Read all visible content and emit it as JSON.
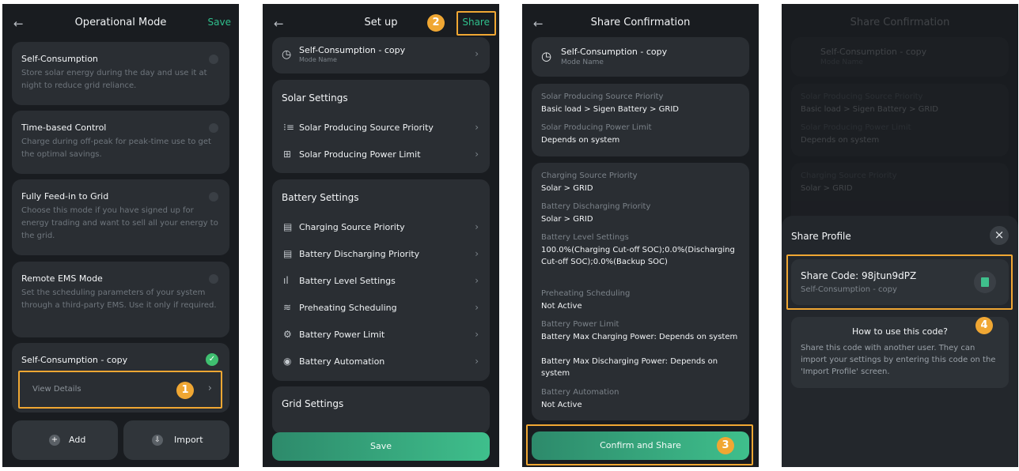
{
  "panel1": {
    "title": "Operational Mode",
    "save": "Save",
    "back": "←",
    "modes": [
      {
        "name": "Self-Consumption",
        "desc": "Store solar energy during the day and use it at night to reduce grid reliance."
      },
      {
        "name": "Time-based Control",
        "desc": "Charge during off-peak for peak-time use to get the optimal savings."
      },
      {
        "name": "Fully Feed-in to Grid",
        "desc": "Choose this mode if you have signed up for energy trading and want to sell all your energy to the grid."
      },
      {
        "name": "Remote EMS Mode",
        "desc": "Set the scheduling parameters of your system through a third-party EMS. Use it only if required."
      }
    ],
    "custom": {
      "name": "Self-Consumption - copy",
      "view": "View Details",
      "check": "✓"
    },
    "add": "Add",
    "import": "Import",
    "badge": "1"
  },
  "panel2": {
    "title": "Set up",
    "share": "Share",
    "back": "←",
    "badge": "2",
    "mode_name": "Self-Consumption - copy",
    "mode_label": "Mode Name",
    "solar_title": "Solar Settings",
    "solar_items": [
      "Solar Producing Source Priority",
      "Solar Producing Power Limit"
    ],
    "battery_title": "Battery Settings",
    "battery_items": [
      "Charging Source Priority",
      "Battery Discharging Priority",
      "Battery Level Settings",
      "Preheating Scheduling",
      "Battery Power Limit",
      "Battery Automation"
    ],
    "grid_title": "Grid Settings",
    "save": "Save"
  },
  "panel3": {
    "title": "Share Confirmation",
    "back": "←",
    "badge": "3",
    "mode_name": "Self-Consumption - copy",
    "mode_label": "Mode Name",
    "solar": [
      {
        "k": "Solar Producing Source Priority",
        "v": "Basic load > Sigen Battery > GRID"
      },
      {
        "k": "Solar Producing Power Limit",
        "v": "Depends on system"
      }
    ],
    "battery": [
      {
        "k": "Charging Source Priority",
        "v": "Solar > GRID"
      },
      {
        "k": "Battery Discharging Priority",
        "v": "Solar > GRID"
      },
      {
        "k": "Battery Level Settings",
        "v": "100.0%(Charging Cut-off SOC);0.0%(Discharging Cut-off SOC);0.0%(Backup SOC)"
      },
      {
        "k": "Preheating Scheduling",
        "v": "Not Active"
      },
      {
        "k": "Battery Power Limit",
        "v": "Battery Max Charging Power: Depends on system"
      },
      {
        "k": "",
        "v": "Battery Max Discharging Power: Depends on system"
      },
      {
        "k": "Battery Automation",
        "v": "Not Active"
      }
    ],
    "confirm": "Confirm and Share"
  },
  "panel4": {
    "bg_title": "Share Confirmation",
    "bg_lines": [
      "Self-Consumption - copy",
      "Mode Name",
      "Solar Producing Source Priority",
      "Basic load > Sigen Battery > GRID",
      "Solar Producing Power Limit",
      "Depends on system",
      "Charging Source Priority",
      "Solar > GRID"
    ],
    "sheet_title": "Share Profile",
    "close": "×",
    "code_label": "Share Code: 98jtun9dPZ",
    "code_sub": "Self-Consumption - copy",
    "howto_title": "How to use this code?",
    "howto_text": "Share this code with another user. They can import your settings by entering this code on the 'Import Profile' screen.",
    "badge": "4"
  },
  "colors": {
    "accent": "#3fbf8c",
    "highlight": "#f0a733",
    "bg": "#191c20",
    "card": "#2a2e33"
  }
}
